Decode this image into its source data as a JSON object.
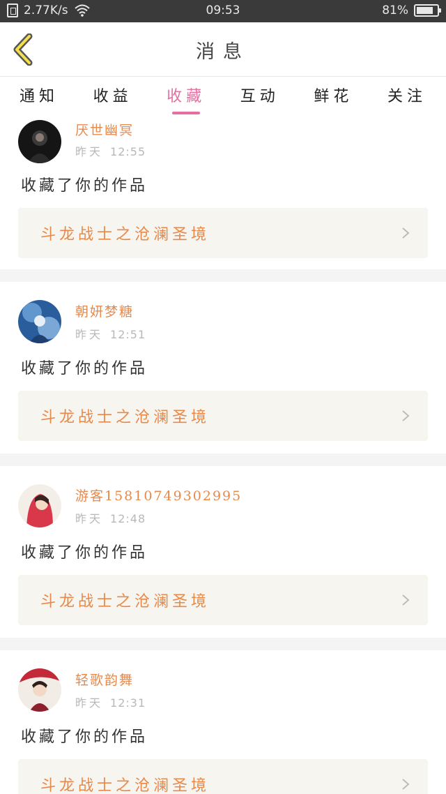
{
  "status_bar": {
    "speed": "2.77K/s",
    "time": "09:53",
    "battery": "81%",
    "battery_level": 0.81
  },
  "header": {
    "title": "消息",
    "back_icon": "chevron-left-icon"
  },
  "tabs": [
    {
      "label": "通知",
      "active": false
    },
    {
      "label": "收益",
      "active": false
    },
    {
      "label": "收藏",
      "active": true
    },
    {
      "label": "互动",
      "active": false
    },
    {
      "label": "鲜花",
      "active": false
    },
    {
      "label": "关注",
      "active": false
    }
  ],
  "colors": {
    "accent_pink": "#e66f9f",
    "username_orange": "#e8894a",
    "status_bar_bg": "#3a3a3a"
  },
  "notifications": [
    {
      "username": "厌世幽冥",
      "day": "昨天",
      "time": "12:55",
      "action": "收藏了你的作品",
      "work_title": "斗龙战士之沧澜圣境"
    },
    {
      "username": "朝妍梦糖",
      "day": "昨天",
      "time": "12:51",
      "action": "收藏了你的作品",
      "work_title": "斗龙战士之沧澜圣境"
    },
    {
      "username": "游客15810749302995",
      "day": "昨天",
      "time": "12:48",
      "action": "收藏了你的作品",
      "work_title": "斗龙战士之沧澜圣境"
    },
    {
      "username": "轻歌韵舞",
      "day": "昨天",
      "time": "12:31",
      "action": "收藏了你的作品",
      "work_title": "斗龙战士之沧澜圣境"
    }
  ]
}
